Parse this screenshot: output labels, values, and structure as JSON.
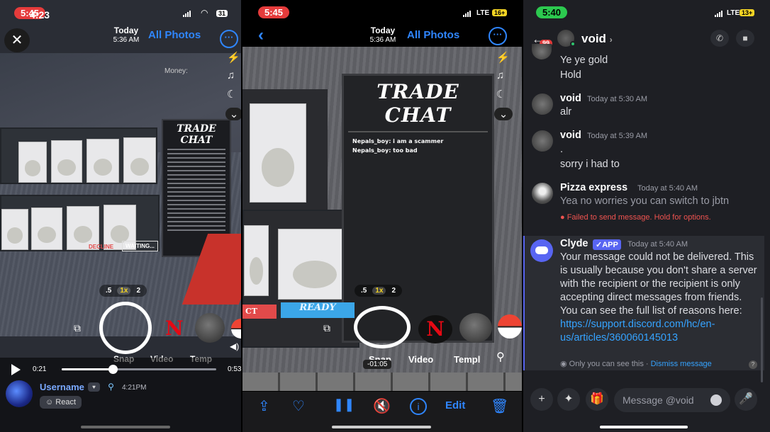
{
  "panel1": {
    "status_time_a": "5:45",
    "status_time_b": "4:23",
    "battery": "31",
    "header_title": "Today",
    "header_subtitle": "5:36 AM",
    "nav_label": "All Photos",
    "money_label": "Money:",
    "trade_chat_title": "TRADE CHAT",
    "decline_label": "DECLINE",
    "waiting_label": "WAITING...",
    "zoom": [
      ".5",
      "1x",
      "2"
    ],
    "modes": [
      "Snap",
      "Video",
      "Temp"
    ],
    "time_elapsed": "0:21",
    "time_total": "0:53",
    "progress": 0.33,
    "username": "Username",
    "post_time": "4:21PM",
    "react_label": "React"
  },
  "panel2": {
    "status_time": "5:45",
    "network": "LTE",
    "battery": "16+",
    "header_title": "Today",
    "header_subtitle": "5:36 AM",
    "nav_label": "All Photos",
    "trade_chat_title": "TRADE CHAT",
    "chat_lines": [
      "Nepals_boy: i am a scammer",
      "Nepals_boy: too bad"
    ],
    "decline_label": "CT",
    "ready_label": "READY",
    "zoom": [
      ".5",
      "1x",
      "2"
    ],
    "modes": [
      "Snap",
      "Video",
      "Templ"
    ],
    "timeline_time": "-01:05",
    "edit_label": "Edit"
  },
  "panel3": {
    "status_time": "5:40",
    "network": "LTE",
    "battery": "13+",
    "unread_badge": "99",
    "dm_name": "void",
    "dm_chevron": "›",
    "messages": [
      {
        "lines": [
          "Ye ye gold",
          "Hold"
        ]
      },
      {
        "author": "void",
        "time": "Today at 5:30 AM",
        "lines": [
          "alr"
        ]
      },
      {
        "author": "void",
        "time": "Today at 5:39 AM",
        "lines": [
          ".",
          "sorry  i had to"
        ]
      },
      {
        "author": "Pizza express",
        "time": "Today at 5:40 AM",
        "lines": [
          "Yea no worries you can switch to jbtn"
        ],
        "error": "Failed to send message. Hold for options."
      }
    ],
    "clyde": {
      "author": "Clyde",
      "badge": "✓APP",
      "time": "Today at 5:40 AM",
      "text": "Your message could not be delivered. This is usually because you don't share a server with the recipient or the recipient is only accepting direct messages from friends. You can see the full list of reasons here: ",
      "link": "https://support.discord.com/hc/en-us/articles/360060145013",
      "only_you": "Only you can see this",
      "dismiss": "Dismiss message"
    },
    "input_placeholder": "Message @void"
  }
}
